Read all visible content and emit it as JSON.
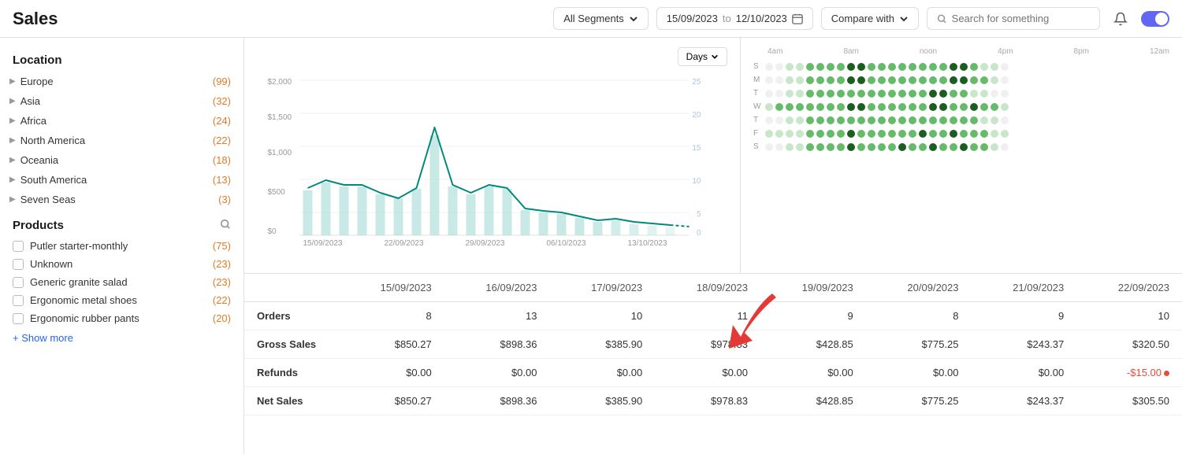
{
  "header": {
    "title": "Sales",
    "segments_label": "All Segments",
    "date_from": "15/09/2023",
    "date_to": "12/10/2023",
    "compare_label": "Compare with",
    "search_placeholder": "Search for something",
    "days_label": "Days"
  },
  "sidebar": {
    "location_title": "Location",
    "items": [
      {
        "name": "Europe",
        "count": "(99)",
        "expanded": false
      },
      {
        "name": "Asia",
        "count": "(32)",
        "expanded": false
      },
      {
        "name": "Africa",
        "count": "(24)",
        "expanded": false
      },
      {
        "name": "North America",
        "count": "(22)",
        "expanded": false
      },
      {
        "name": "Oceania",
        "count": "(18)",
        "expanded": false
      },
      {
        "name": "South America",
        "count": "(13)",
        "expanded": false
      },
      {
        "name": "Seven Seas",
        "count": "(3)",
        "expanded": false
      }
    ],
    "products_title": "Products",
    "products": [
      {
        "name": "Putler starter-monthly",
        "count": "(75)",
        "checked": false
      },
      {
        "name": "Unknown",
        "count": "(23)",
        "checked": false
      },
      {
        "name": "Generic granite salad",
        "count": "(23)",
        "checked": false
      },
      {
        "name": "Ergonomic metal shoes",
        "count": "(22)",
        "checked": false
      },
      {
        "name": "Ergonomic rubber pants",
        "count": "(20)",
        "checked": false
      }
    ],
    "show_more_label": "+ Show more"
  },
  "chart": {
    "y_labels": [
      "$2,000",
      "$1,500",
      "$1,000",
      "$500",
      "$0"
    ],
    "y_right_labels": [
      "25",
      "20",
      "15",
      "10",
      "5",
      "0"
    ],
    "x_labels": [
      "15/09/2023",
      "22/09/2023",
      "29/09/2023",
      "06/10/2023",
      "13/10/2023"
    ]
  },
  "dot_chart": {
    "time_labels": [
      "4am",
      "8am",
      "noon",
      "4pm",
      "8pm",
      "12am"
    ],
    "days": [
      "S",
      "M",
      "T",
      "W",
      "T",
      "F",
      "S"
    ]
  },
  "table": {
    "columns": [
      "",
      "15/09/2023",
      "16/09/2023",
      "17/09/2023",
      "18/09/2023",
      "19/09/2023",
      "20/09/2023",
      "21/09/2023",
      "22/09/2023"
    ],
    "rows": [
      {
        "label": "Orders",
        "values": [
          "8",
          "13",
          "10",
          "11",
          "9",
          "8",
          "9",
          "10"
        ]
      },
      {
        "label": "Gross Sales",
        "values": [
          "$850.27",
          "$898.36",
          "$385.90",
          "$978.83",
          "$428.85",
          "$775.25",
          "$243.37",
          "$320.50"
        ]
      },
      {
        "label": "Refunds",
        "values": [
          "$0.00",
          "$0.00",
          "$0.00",
          "$0.00",
          "$0.00",
          "$0.00",
          "$0.00",
          "-$15.00"
        ]
      },
      {
        "label": "Net Sales",
        "values": [
          "$850.27",
          "$898.36",
          "$385.90",
          "$978.83",
          "$428.85",
          "$775.25",
          "$243.37",
          "$305.50"
        ]
      }
    ]
  }
}
